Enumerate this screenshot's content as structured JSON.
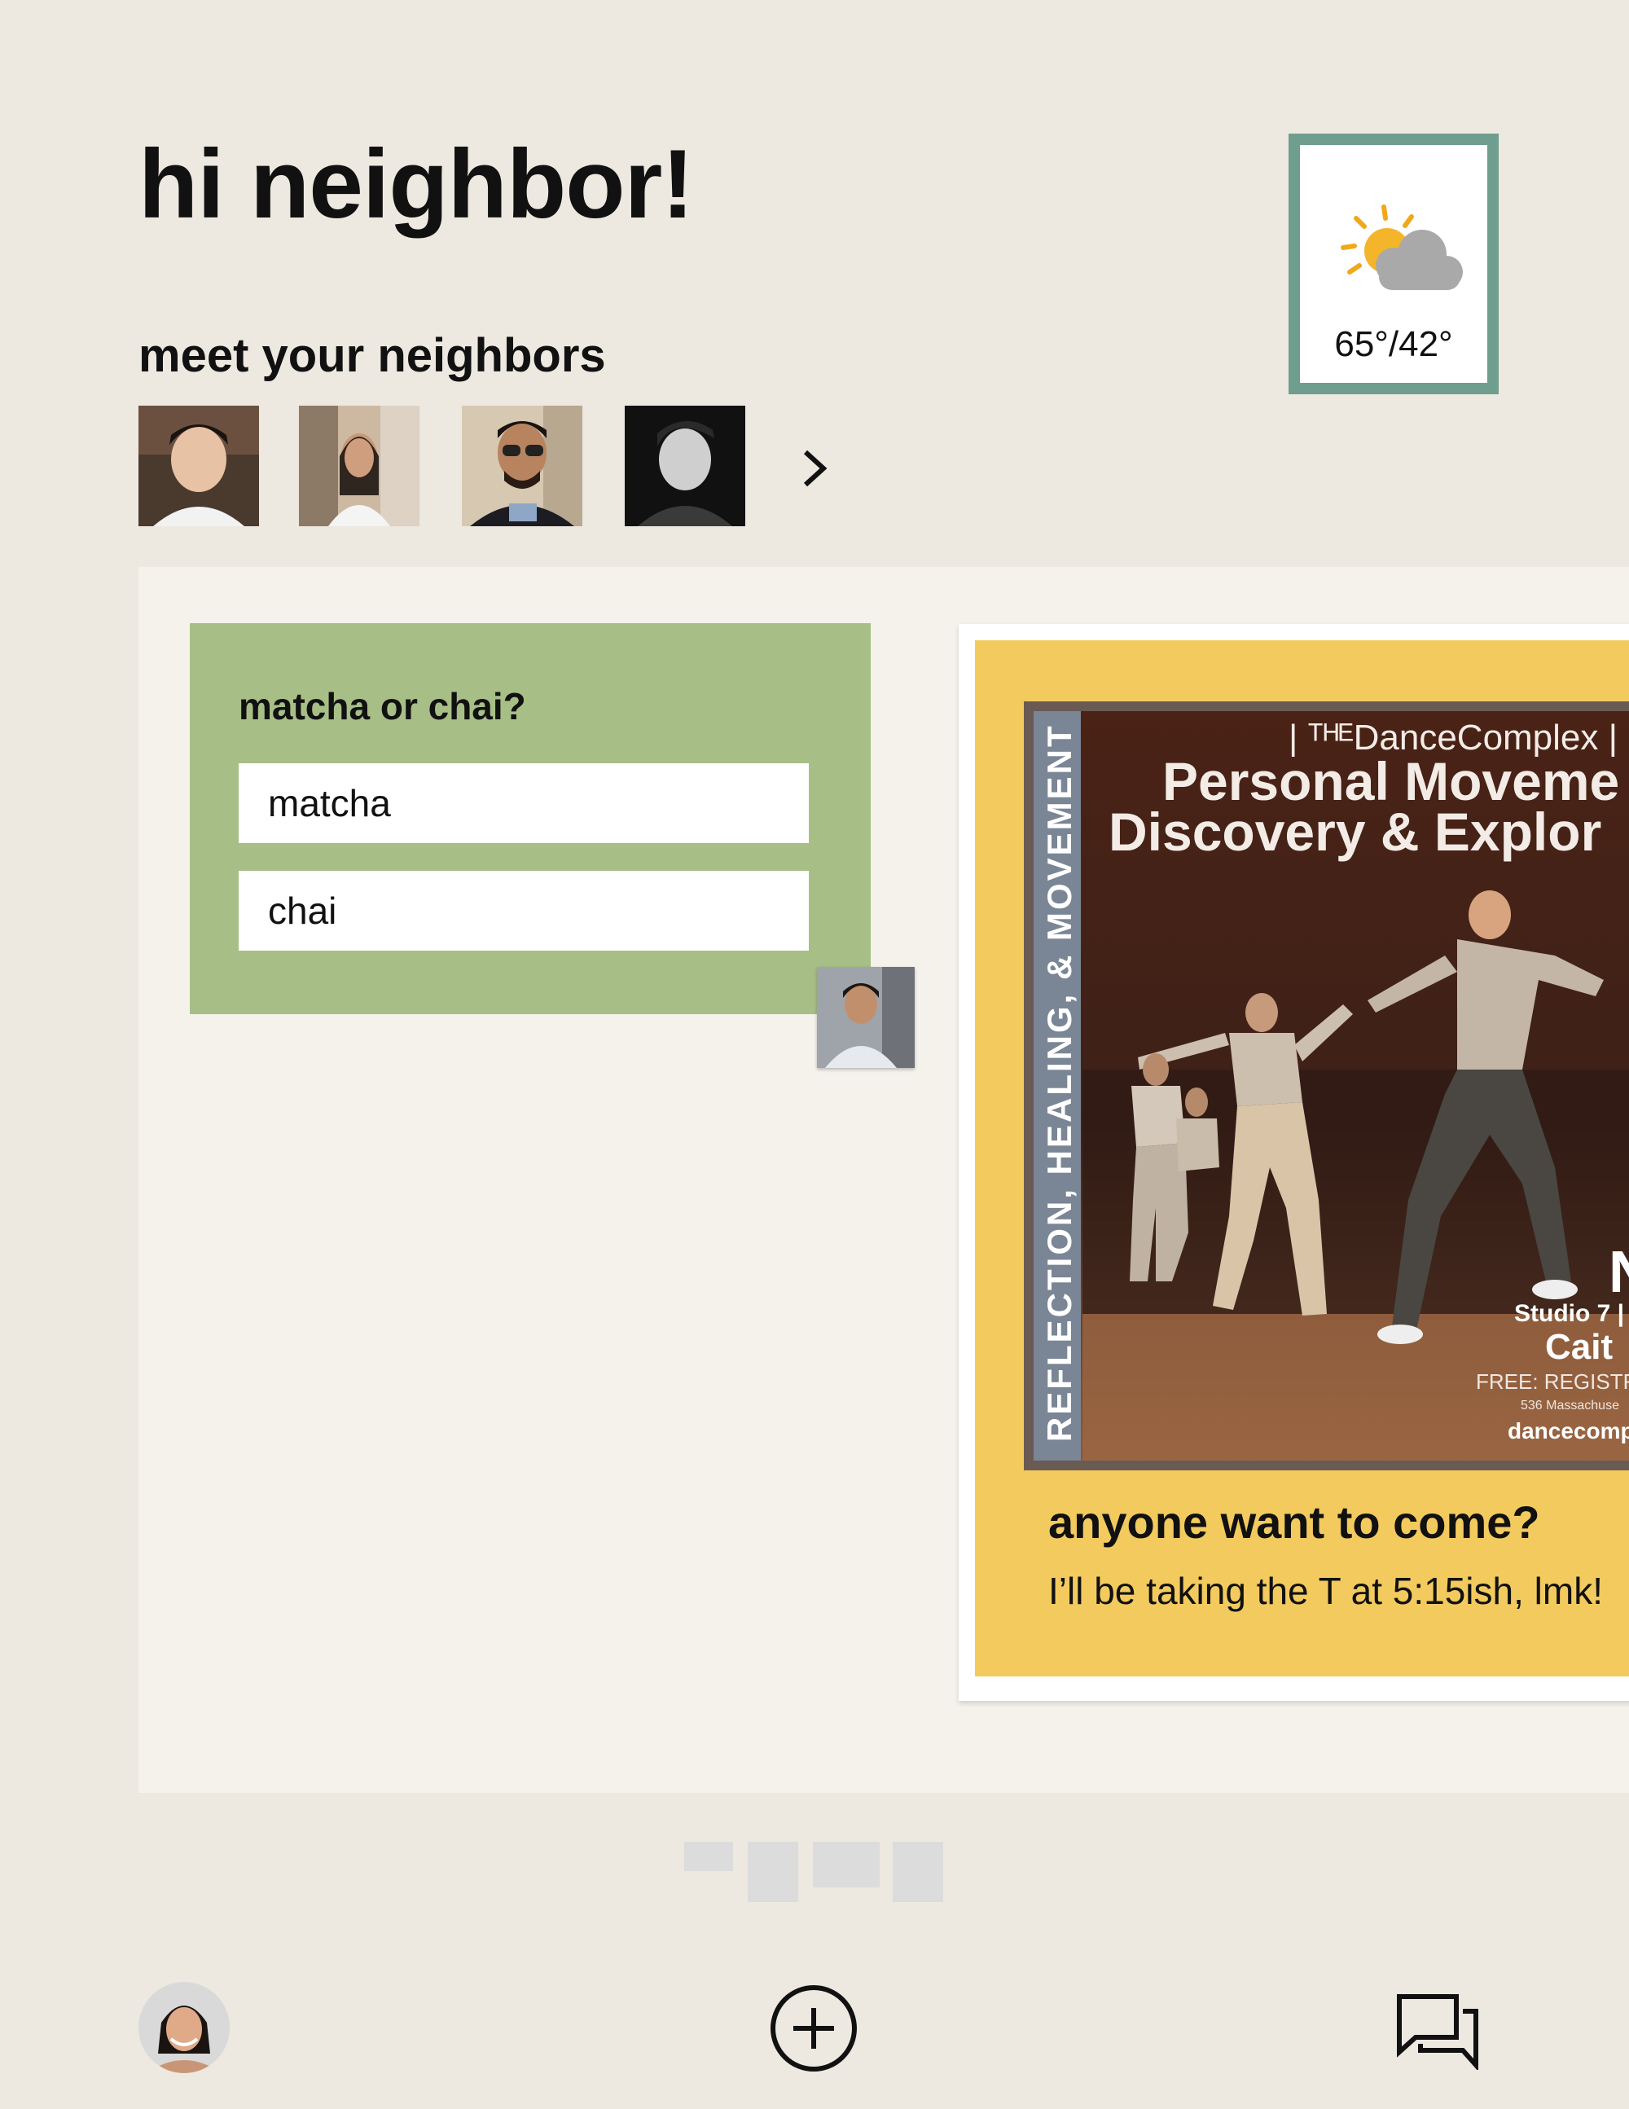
{
  "header": {
    "greeting": "hi neighbor!",
    "meet_label": "meet your neighbors"
  },
  "weather": {
    "icon": "partly-cloudy-icon",
    "temperature": "65°/42°"
  },
  "neighbors": {
    "count_visible": 4,
    "next_icon": "chevron-right-icon"
  },
  "poll": {
    "question": "matcha or chai?",
    "options": [
      "matcha",
      "chai"
    ]
  },
  "event": {
    "poster": {
      "vertical_text": "REFLECTION, HEALING, & MOVEMENT",
      "brand": "| ᵀᴴᴱDanceComplex |",
      "title_line1": "Personal Moveme",
      "title_line2": "Discovery & Explor",
      "fragment_n": "N",
      "studio": "Studio 7 |",
      "host": "Cait",
      "registration": "FREE: REGISTRAT",
      "address": "536 Massachuse",
      "url": "dancecomp"
    },
    "title": "anyone want to come?",
    "body": "I’ll be taking the T at 5:15ish, lmk!"
  },
  "nav": {
    "profile_icon": "avatar",
    "add_icon": "add-circle-icon",
    "messages_icon": "chat-icon"
  },
  "colors": {
    "background": "#ede8e0",
    "board": "#f5f2ec",
    "poll_card": "#a7bf87",
    "event_card": "#f3ca5e",
    "weather_border": "#6f9d8e"
  }
}
